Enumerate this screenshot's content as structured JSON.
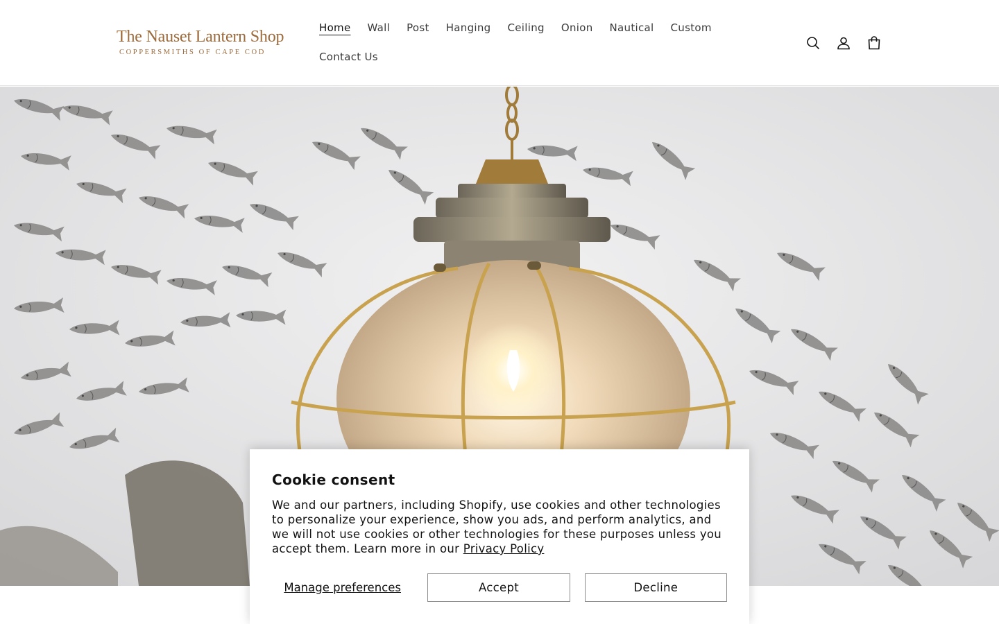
{
  "brand": {
    "title": "The Nauset Lantern Shop",
    "subtitle": "COPPERSMITHS OF CAPE COD",
    "color": "#9c6a3b"
  },
  "nav": {
    "items": [
      {
        "label": "Home",
        "active": true
      },
      {
        "label": "Wall",
        "active": false
      },
      {
        "label": "Post",
        "active": false
      },
      {
        "label": "Hanging",
        "active": false
      },
      {
        "label": "Ceiling",
        "active": false
      },
      {
        "label": "Onion",
        "active": false
      },
      {
        "label": "Nautical",
        "active": false
      },
      {
        "label": "Custom",
        "active": false
      },
      {
        "label": "Contact Us",
        "active": false
      }
    ]
  },
  "header_icons": [
    "search-icon",
    "account-icon",
    "cart-icon"
  ],
  "hero": {
    "image": "brass-onion-lantern-with-metal-fish-school",
    "background_color": "#e9eaec"
  },
  "cookie": {
    "title": "Cookie consent",
    "text": "We and our partners, including Shopify, use cookies and other technologies to personalize your experience, show you ads, and perform analytics, and we will not use cookies or other technologies for these purposes unless you accept them. Learn more in our ",
    "link_label": "Privacy Policy",
    "manage_label": "Manage preferences",
    "accept_label": "Accept",
    "decline_label": "Decline"
  }
}
